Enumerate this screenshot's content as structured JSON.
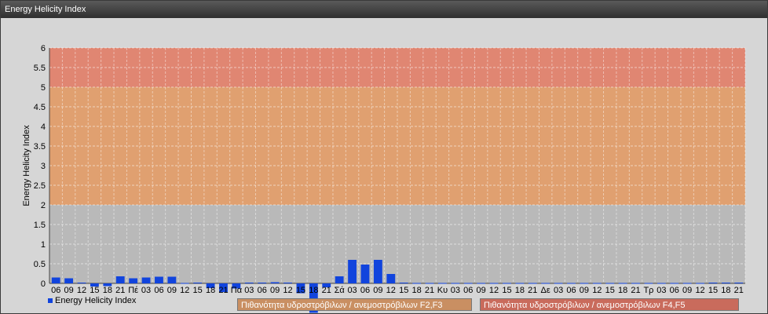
{
  "window": {
    "title": "Energy Helicity Index"
  },
  "legend": {
    "series_label": "Energy Helicity Index",
    "band_f2f3": "Πιθανότητα υδροστρόβιλων / ανεμοστρόβιλων F2,F3",
    "band_f4f5": "Πιθανότητα υδροστρόβιλων / ανεμοστρόβιλων F4,F5"
  },
  "colors": {
    "bar": "#1144dd",
    "band_low": "#b9b9b9",
    "band_mid": "#e0a070",
    "band_high": "#e08672",
    "box_f2f3": "#c98f62",
    "box_f4f5": "#c96b5c"
  },
  "chart_data": {
    "type": "bar",
    "title": "",
    "ylabel": "Energy Helicity Index",
    "ylim": [
      0,
      6
    ],
    "yticks": [
      "0",
      "0.5",
      "1",
      "1.5",
      "2",
      "2.5",
      "3",
      "3.5",
      "4",
      "4.5",
      "5",
      "5.5",
      "6"
    ],
    "bands": [
      {
        "from": 0,
        "to": 2,
        "color": "#b9b9b9"
      },
      {
        "from": 2,
        "to": 5,
        "color": "#e0a070",
        "label": "Πιθανότητα υδροστρόβιλων / ανεμοστρόβιλων F2,F3"
      },
      {
        "from": 5,
        "to": 6,
        "color": "#e08672",
        "label": "Πιθανότητα υδροστρόβιλων / ανεμοστρόβιλων F4,F5"
      }
    ],
    "categories": [
      "06",
      "09",
      "12",
      "15",
      "18",
      "21",
      "Πέ",
      "03",
      "06",
      "09",
      "12",
      "15",
      "18",
      "21",
      "Πα",
      "03",
      "06",
      "09",
      "12",
      "15",
      "18",
      "21",
      "Σά",
      "03",
      "06",
      "09",
      "12",
      "15",
      "18",
      "21",
      "Κυ",
      "03",
      "06",
      "09",
      "12",
      "15",
      "18",
      "21",
      "Δε",
      "03",
      "06",
      "09",
      "12",
      "15",
      "18",
      "21",
      "Τρ",
      "03",
      "06",
      "09",
      "12",
      "15",
      "18",
      "21"
    ],
    "series": [
      {
        "name": "Energy Helicity Index",
        "values": [
          0.15,
          0.13,
          0.02,
          -0.08,
          -0.07,
          0.18,
          0.13,
          0.15,
          0.17,
          0.17,
          0.01,
          0.02,
          -0.12,
          -0.22,
          -0.13,
          0.02,
          0.02,
          0.03,
          0.02,
          -0.25,
          -0.75,
          -0.1,
          0.18,
          0.6,
          0.48,
          0.6,
          0.24,
          0.02,
          0.01,
          0.01,
          0.01,
          0.01,
          0.01,
          0.01,
          0.01,
          0.01,
          0.01,
          0.01,
          0.01,
          0.01,
          0.01,
          0.01,
          0.01,
          0.01,
          0.01,
          0.01,
          0.01,
          0.01,
          0.01,
          0.01,
          0.01,
          0.02,
          0.02,
          0.02
        ]
      }
    ]
  }
}
